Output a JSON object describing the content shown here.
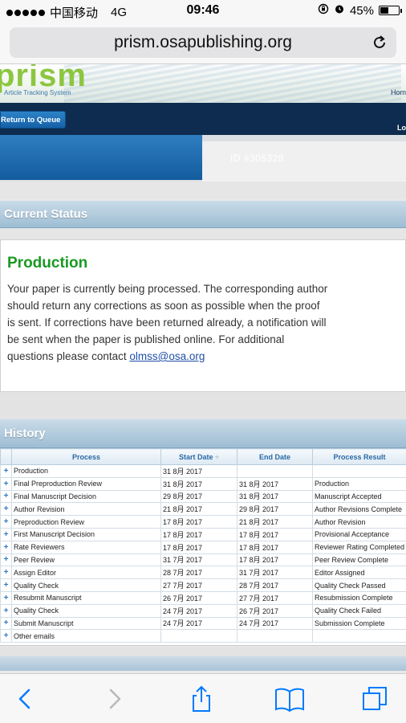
{
  "status_bar": {
    "carrier": "中国移动",
    "network": "4G",
    "time": "09:46",
    "battery": "45%",
    "battery_level": 0.45
  },
  "browser": {
    "url": "prism.osapublishing.org"
  },
  "site": {
    "logo": "prism",
    "logo_sub": "Article Tracking System",
    "home_link": "Hom",
    "return_button": "Return to Queue",
    "logout_fragment": "Lo",
    "id_label": "ID #305328"
  },
  "current_status": {
    "heading": "Current Status",
    "title": "Production",
    "text": "Your paper is currently being processed. The corresponding author should return any corrections as soon as possible when the proof is sent. If corrections have been returned already, a notification will be sent when the paper is published online. For additional questions please contact ",
    "email": "olmss@osa.org"
  },
  "history": {
    "heading": "History",
    "columns": [
      "Process",
      "Start Date",
      "End Date",
      "Process Result"
    ],
    "sort_indicator": "÷",
    "rows": [
      {
        "process": "Production",
        "start": "31 8月 2017",
        "end": "",
        "result": ""
      },
      {
        "process": "Final Preproduction Review",
        "start": "31 8月 2017",
        "end": "31 8月 2017",
        "result": "Production"
      },
      {
        "process": "Final Manuscript Decision",
        "start": "29 8月 2017",
        "end": "31 8月 2017",
        "result": "Manuscript Accepted"
      },
      {
        "process": "Author Revision",
        "start": "21 8月 2017",
        "end": "29 8月 2017",
        "result": "Author Revisions Complete"
      },
      {
        "process": "Preproduction Review",
        "start": "17 8月 2017",
        "end": "21 8月 2017",
        "result": "Author Revision"
      },
      {
        "process": "First Manuscript Decision",
        "start": "17 8月 2017",
        "end": "17 8月 2017",
        "result": "Provisional Acceptance"
      },
      {
        "process": "Rate Reviewers",
        "start": "17 8月 2017",
        "end": "17 8月 2017",
        "result": "Reviewer Rating Completed"
      },
      {
        "process": "Peer Review",
        "start": "31 7月 2017",
        "end": "17 8月 2017",
        "result": "Peer Review Complete"
      },
      {
        "process": "Assign Editor",
        "start": "28 7月 2017",
        "end": "31 7月 2017",
        "result": "Editor Assigned"
      },
      {
        "process": "Quality Check",
        "start": "27 7月 2017",
        "end": "28 7月 2017",
        "result": "Quality Check Passed"
      },
      {
        "process": "Resubmit Manuscript",
        "start": "26 7月 2017",
        "end": "27 7月 2017",
        "result": "Resubmission Complete"
      },
      {
        "process": "Quality Check",
        "start": "24 7月 2017",
        "end": "26 7月 2017",
        "result": "Quality Check Failed"
      },
      {
        "process": "Submit Manuscript",
        "start": "24 7月 2017",
        "end": "24 7月 2017",
        "result": "Submission Complete"
      },
      {
        "process": "Other emails",
        "start": "",
        "end": "",
        "result": ""
      }
    ]
  },
  "colors": {
    "production_green": "#1a9a22",
    "nav_dark": "#0e2c4f",
    "accent_blue": "#007aff"
  }
}
